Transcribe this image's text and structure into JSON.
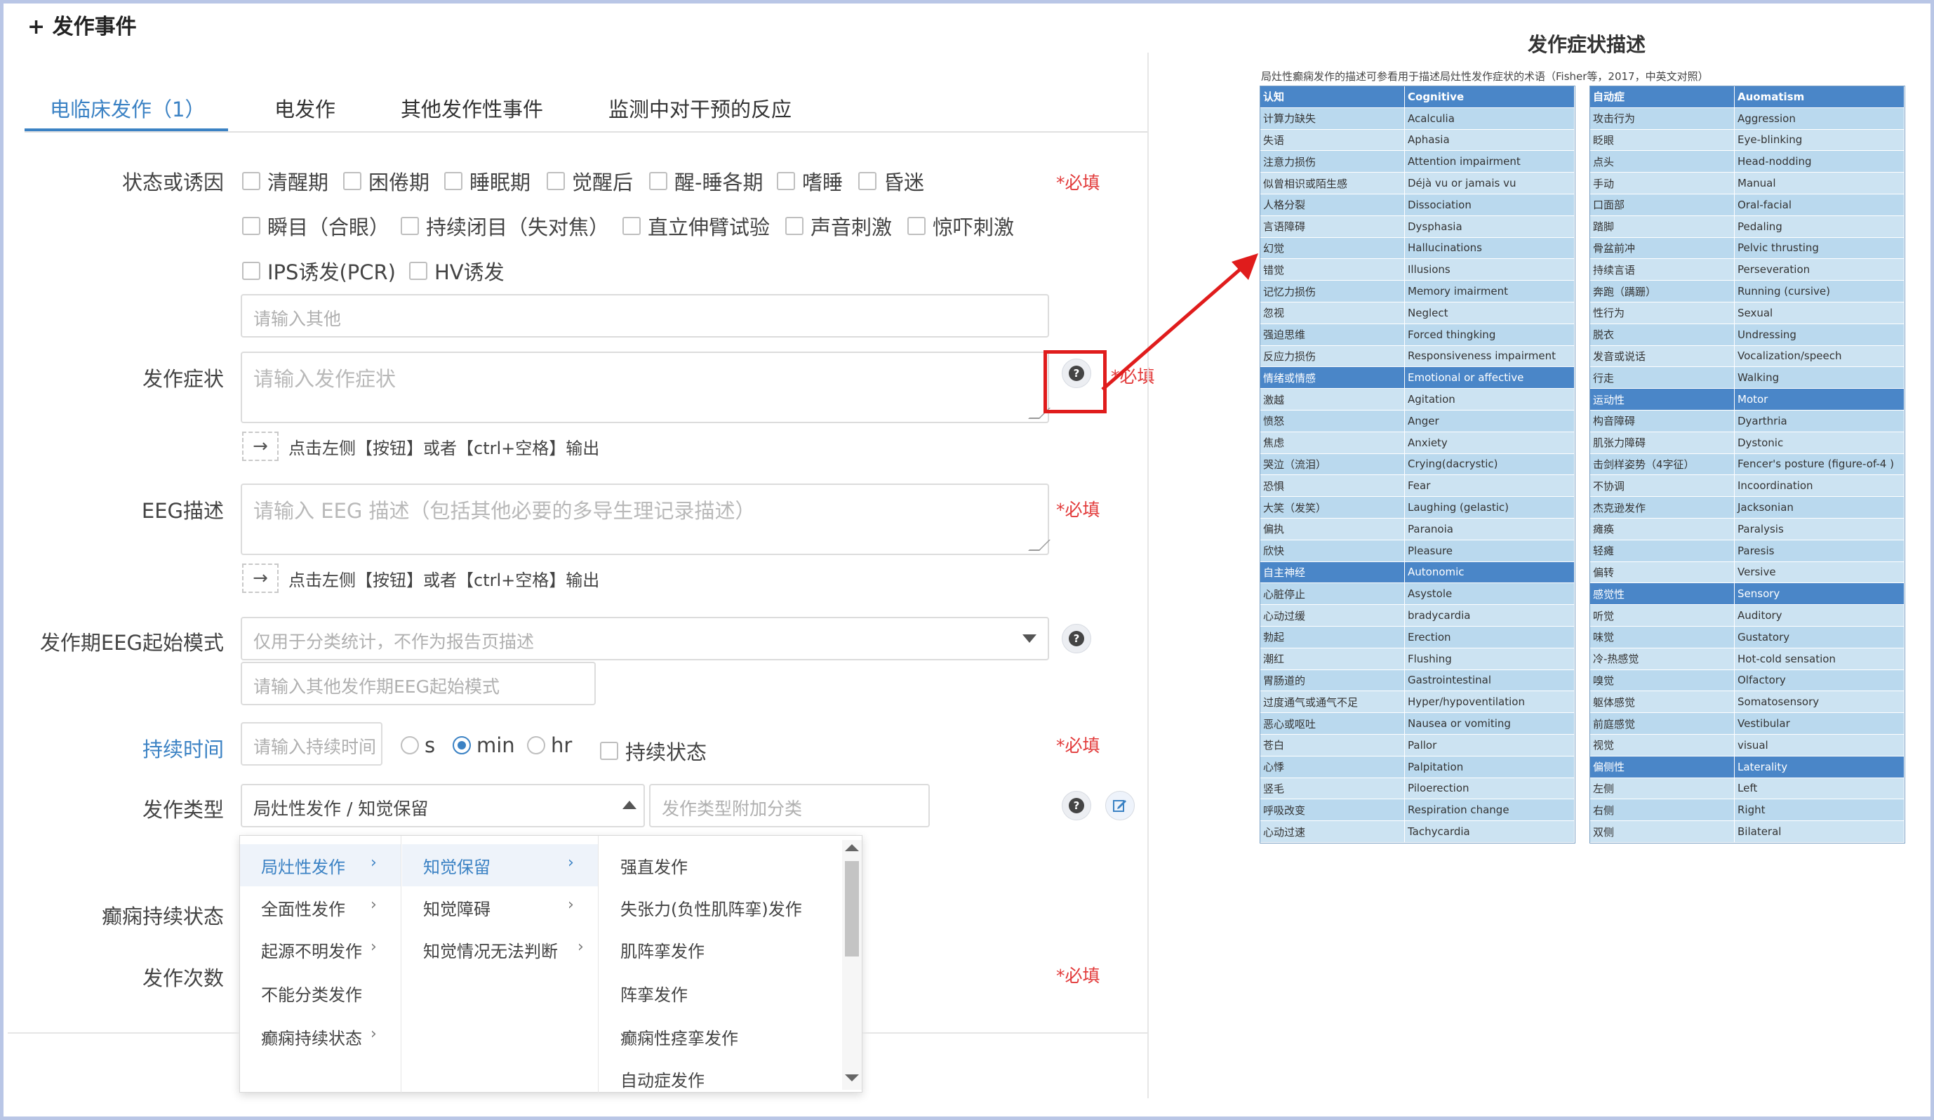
{
  "page_title": "+ 发作事件",
  "tabs": [
    "电临床发作（1）",
    "电发作",
    "其他发作性事件",
    "监测中对干预的反应"
  ],
  "state": {
    "label": "状态或诱因",
    "required": "*必填",
    "row1": [
      "清醒期",
      "困倦期",
      "睡眠期",
      "觉醒后",
      "醒-睡各期",
      "嗜睡",
      "昏迷"
    ],
    "row2": [
      "瞬目（合眼）",
      "持续闭目（失对焦）",
      "直立伸臂试验",
      "声音刺激",
      "惊吓刺激"
    ],
    "row3": [
      "IPS诱发(PCR)",
      "HV诱发"
    ],
    "other_placeholder": "请输入其他"
  },
  "symptom": {
    "label": "发作症状",
    "placeholder": "请输入发作症状",
    "required": "*必填",
    "hint": "点击左侧【按钮】或者【ctrl+空格】输出",
    "arrow": "→"
  },
  "eeg": {
    "label": "EEG描述",
    "placeholder": "请输入 EEG 描述（包括其他必要的多导生理记录描述）",
    "required": "*必填",
    "hint": "点击左侧【按钮】或者【ctrl+空格】输出",
    "arrow": "→"
  },
  "onset": {
    "label": "发作期EEG起始模式",
    "placeholder": "仅用于分类统计，不作为报告页描述",
    "other_placeholder": "请输入其他发作期EEG起始模式"
  },
  "duration": {
    "label": "持续时间",
    "placeholder": "请输入持续时间",
    "units": [
      "s",
      "min",
      "hr"
    ],
    "selected_unit": "min",
    "continuous_label": "持续状态",
    "required": "*必填"
  },
  "type": {
    "label": "发作类型",
    "value": "局灶性发作 / 知觉保留",
    "extra_placeholder": "发作类型附加分类"
  },
  "status_label": "癫痫持续状态",
  "count": {
    "label": "发作次数",
    "required": "*必填"
  },
  "help_icon": "?",
  "cascader": {
    "col1": [
      "局灶性发作",
      "全面性发作",
      "起源不明发作",
      "不能分类发作",
      "癫痫持续状态"
    ],
    "col2": [
      "知觉保留",
      "知觉障碍",
      "知觉情况无法判断"
    ],
    "col3": [
      "强直发作",
      "失张力(负性肌阵挛)发作",
      "肌阵挛发作",
      "阵挛发作",
      "癫痫性痉挛发作",
      "自动症发作"
    ],
    "arrow": "›"
  },
  "reference": {
    "title": "发作症状描述",
    "subtitle": "局灶性癫痫发作的描述可参看用于描述局灶性发作症状的术语（Fisher等，2017，中英文对照）",
    "left": [
      [
        "认知",
        "Cognitive",
        "head"
      ],
      [
        "计算力缺失",
        "Acalculia"
      ],
      [
        "失语",
        "Aphasia"
      ],
      [
        "注意力损伤",
        "Attention impairment"
      ],
      [
        "似曾相识或陌生感",
        "Déjà vu or jamais vu"
      ],
      [
        "人格分裂",
        "Dissociation"
      ],
      [
        "言语障碍",
        "Dysphasia"
      ],
      [
        "幻觉",
        "Hallucinations"
      ],
      [
        "错觉",
        "Illusions"
      ],
      [
        "记忆力损伤",
        "Memory imairment"
      ],
      [
        "忽视",
        "Neglect"
      ],
      [
        "强迫思维",
        "Forced thingking"
      ],
      [
        "反应力损伤",
        "Responsiveness impairment"
      ],
      [
        "情绪或情感",
        "Emotional or affective",
        "cat"
      ],
      [
        "激越",
        "Agitation"
      ],
      [
        "愤怒",
        "Anger"
      ],
      [
        "焦虑",
        "Anxiety"
      ],
      [
        "哭泣（流泪）",
        "Crying(dacrystic)"
      ],
      [
        "恐惧",
        "Fear"
      ],
      [
        "大笑（发笑）",
        "Laughing (gelastic)"
      ],
      [
        "偏执",
        "Paranoia"
      ],
      [
        "欣快",
        "Pleasure"
      ],
      [
        "自主神经",
        "Autonomic",
        "cat"
      ],
      [
        "心脏停止",
        "Asystole"
      ],
      [
        "心动过缓",
        "bradycardia"
      ],
      [
        "勃起",
        "Erection"
      ],
      [
        "潮红",
        "Flushing"
      ],
      [
        "胃肠道的",
        "Gastrointestinal"
      ],
      [
        "过度通气或通气不足",
        "Hyper/hypoventilation"
      ],
      [
        "恶心或呕吐",
        "Nausea or vomiting"
      ],
      [
        "苍白",
        "Pallor"
      ],
      [
        "心悸",
        "Palpitation"
      ],
      [
        "竖毛",
        "Piloerection"
      ],
      [
        "呼吸改变",
        "Respiration change"
      ],
      [
        "心动过速",
        "Tachycardia"
      ]
    ],
    "right": [
      [
        "自动症",
        "Auomatism",
        "head"
      ],
      [
        "攻击行为",
        "Aggression"
      ],
      [
        "眨眼",
        "Eye-blinking"
      ],
      [
        "点头",
        "Head-nodding"
      ],
      [
        "手动",
        "Manual"
      ],
      [
        "口面部",
        "Oral-facial"
      ],
      [
        "踏脚",
        "Pedaling"
      ],
      [
        "骨盆前冲",
        "Pelvic thrusting"
      ],
      [
        "持续言语",
        "Perseveration"
      ],
      [
        "奔跑（蹒跚）",
        "Running (cursive)"
      ],
      [
        "性行为",
        "Sexual"
      ],
      [
        "脱衣",
        "Undressing"
      ],
      [
        "发音或说话",
        "Vocalization/speech"
      ],
      [
        "行走",
        "Walking"
      ],
      [
        "运动性",
        "Motor",
        "cat"
      ],
      [
        "构音障碍",
        "Dyarthria"
      ],
      [
        "肌张力障碍",
        "Dystonic"
      ],
      [
        "击剑样姿势（4字征）",
        "Fencer's posture (figure-of-4 )"
      ],
      [
        "不协调",
        "Incoordination"
      ],
      [
        "杰克逊发作",
        "Jacksonian"
      ],
      [
        "瘫痪",
        "Paralysis"
      ],
      [
        "轻瘫",
        "Paresis"
      ],
      [
        "偏转",
        "Versive"
      ],
      [
        "感觉性",
        "Sensory",
        "cat"
      ],
      [
        "听觉",
        "Auditory"
      ],
      [
        "味觉",
        "Gustatory"
      ],
      [
        "冷-热感觉",
        "Hot-cold sensation"
      ],
      [
        "嗅觉",
        "Olfactory"
      ],
      [
        "躯体感觉",
        "Somatosensory"
      ],
      [
        "前庭感觉",
        "Vestibular"
      ],
      [
        "视觉",
        "visual"
      ],
      [
        "偏侧性",
        "Laterality",
        "cat"
      ],
      [
        "左侧",
        "Left"
      ],
      [
        "右侧",
        "Right"
      ],
      [
        "双侧",
        "Bilateral"
      ]
    ]
  }
}
